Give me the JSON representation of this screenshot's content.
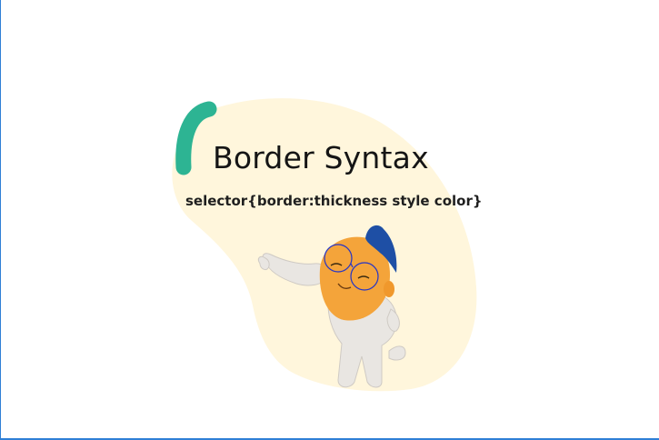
{
  "slide": {
    "title": "Border Syntax",
    "syntax": "selector{border:thickness style color}"
  },
  "colors": {
    "blob": "#fff6dc",
    "accent": "#2db493",
    "frame": "#2f7fd6",
    "skin": "#f4a43a",
    "hair": "#1e4fa5",
    "body": "#e9e6e2",
    "glasses_outline": "#2434c8"
  },
  "icons": {
    "character": "waving-cartoon-character"
  }
}
